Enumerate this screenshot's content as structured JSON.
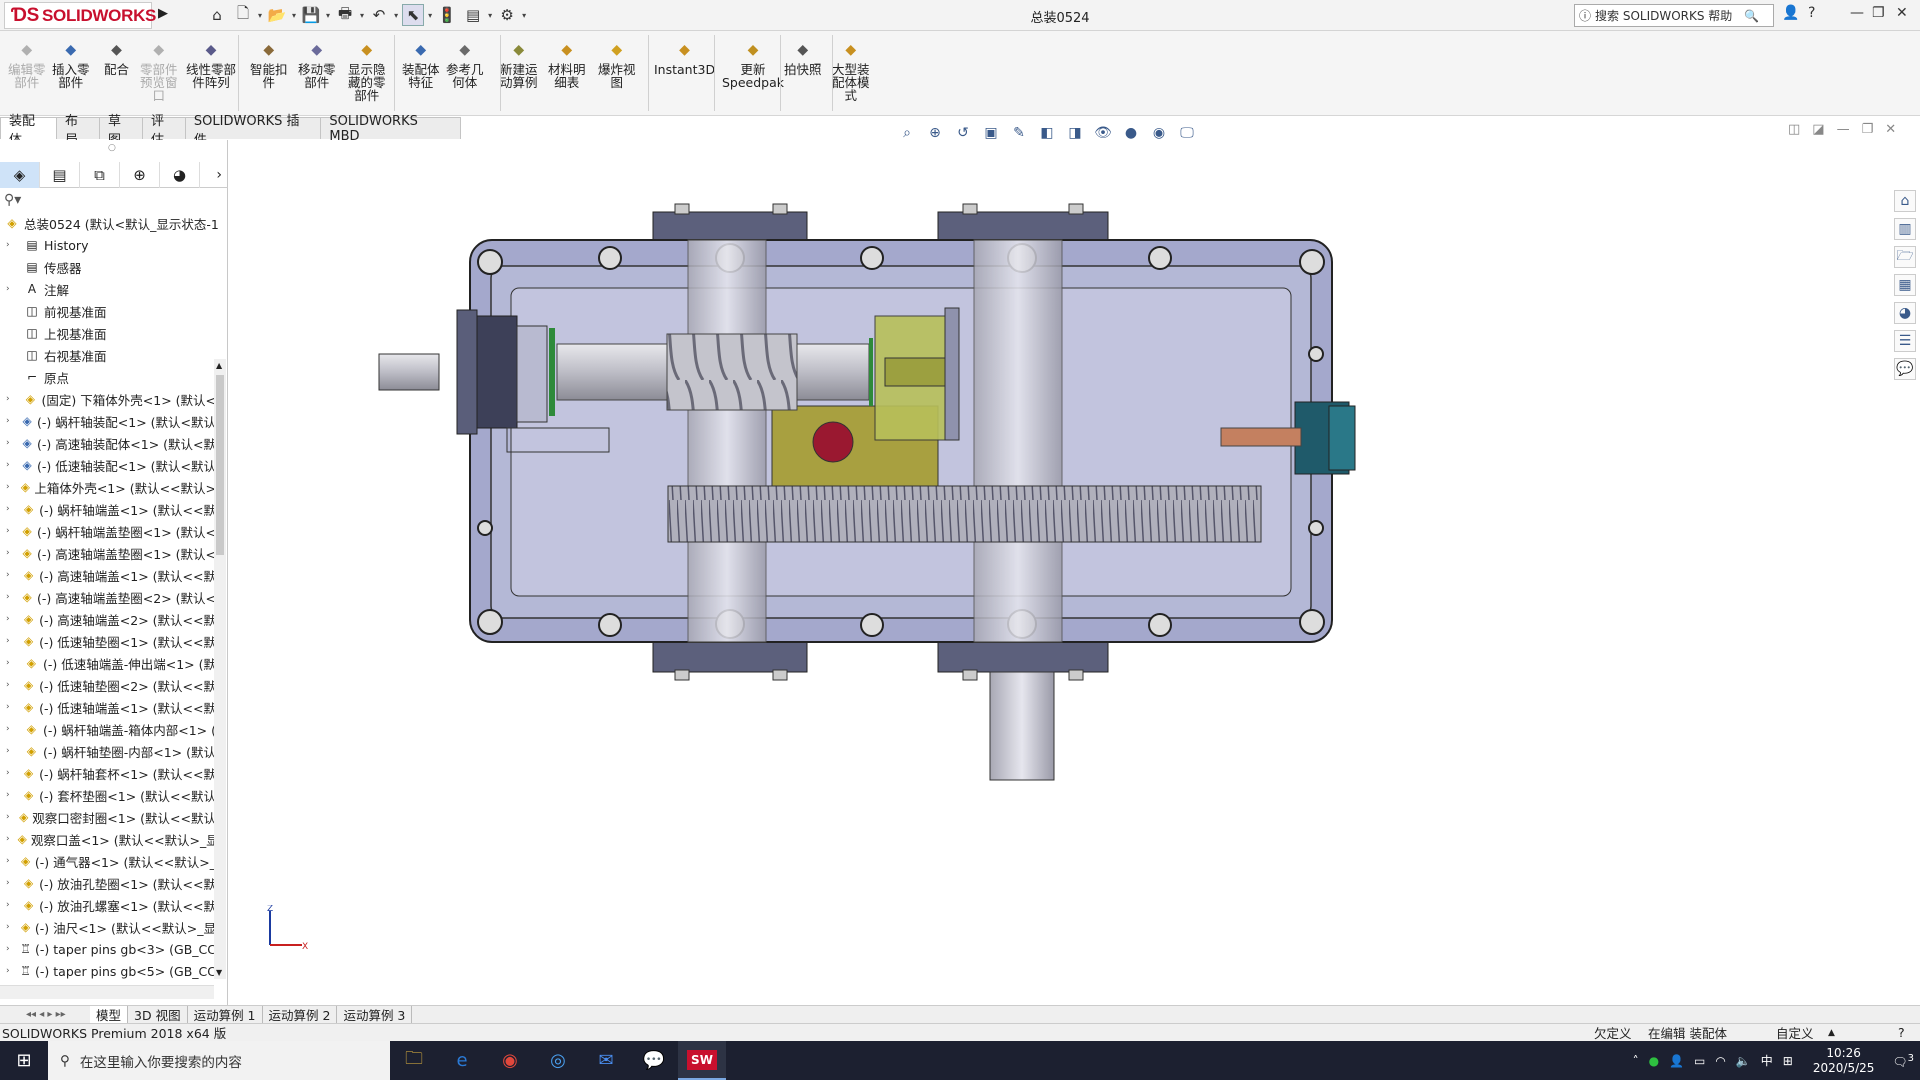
{
  "app": {
    "logo": "SOLIDWORKS",
    "doc_title": "总装0524",
    "help_search": "搜索 SOLIDWORKS 帮助"
  },
  "ribbon": {
    "buttons": [
      {
        "label": "编辑零\n部件",
        "icon": "edit-component-icon",
        "disabled": true
      },
      {
        "label": "插入零\n部件",
        "icon": "insert-components-icon"
      },
      {
        "label": "配合",
        "icon": "mate-icon"
      },
      {
        "label": "零部件\n预览窗\n口",
        "icon": "component-preview-icon",
        "disabled": true
      },
      {
        "label": "线性零部\n件阵列",
        "icon": "linear-pattern-icon"
      },
      {
        "label": "智能扣\n件",
        "icon": "smart-fasteners-icon"
      },
      {
        "label": "移动零\n部件",
        "icon": "move-component-icon"
      },
      {
        "label": "显示隐\n藏的零\n部件",
        "icon": "show-hidden-icon"
      },
      {
        "label": "装配体\n特征",
        "icon": "assembly-features-icon"
      },
      {
        "label": "参考几\n何体",
        "icon": "reference-geometry-icon"
      },
      {
        "label": "新建运\n动算例",
        "icon": "new-motion-study-icon"
      },
      {
        "label": "材料明\n细表",
        "icon": "bom-icon"
      },
      {
        "label": "爆炸视\n图",
        "icon": "exploded-view-icon"
      },
      {
        "label": "Instant3D",
        "icon": "instant3d-icon"
      },
      {
        "label": "更新\nSpeedpak",
        "icon": "speedpak-icon"
      },
      {
        "label": "拍快照",
        "icon": "snapshot-icon"
      },
      {
        "label": "大型装\n配体模\n式",
        "icon": "large-assembly-icon"
      }
    ]
  },
  "command_tabs": [
    "装配体",
    "布局",
    "草图",
    "评估",
    "SOLIDWORKS 插件",
    "SOLIDWORKS MBD"
  ],
  "tree": {
    "root": "总装0524  (默认<默认_显示状态-1",
    "items": [
      {
        "label": "History",
        "type": "folder",
        "expand": true
      },
      {
        "label": "传感器",
        "type": "folder"
      },
      {
        "label": "注解",
        "type": "annot",
        "expand": true
      },
      {
        "label": "前视基准面",
        "type": "plane"
      },
      {
        "label": "上视基准面",
        "type": "plane"
      },
      {
        "label": "右视基准面",
        "type": "plane"
      },
      {
        "label": "原点",
        "type": "origin"
      },
      {
        "label": "(固定) 下箱体外壳<1> (默认<",
        "type": "part",
        "expand": true
      },
      {
        "label": "(-) 蜗杆轴装配<1> (默认<默认",
        "type": "asm",
        "expand": true
      },
      {
        "label": "(-) 高速轴装配体<1> (默认<默",
        "type": "asm",
        "expand": true
      },
      {
        "label": "(-) 低速轴装配<1> (默认<默认",
        "type": "asm",
        "expand": true
      },
      {
        "label": "上箱体外壳<1> (默认<<默认>",
        "type": "part",
        "expand": true
      },
      {
        "label": "(-) 蜗杆轴端盖<1> (默认<<默",
        "type": "part",
        "expand": true
      },
      {
        "label": "(-) 蜗杆轴端盖垫圈<1> (默认<",
        "type": "part",
        "expand": true
      },
      {
        "label": "(-) 高速轴端盖垫圈<1> (默认<",
        "type": "part",
        "expand": true
      },
      {
        "label": "(-) 高速轴端盖<1> (默认<<默",
        "type": "part",
        "expand": true
      },
      {
        "label": "(-) 高速轴端盖垫圈<2> (默认<",
        "type": "part",
        "expand": true
      },
      {
        "label": "(-) 高速轴端盖<2> (默认<<默",
        "type": "part",
        "expand": true
      },
      {
        "label": "(-) 低速轴垫圈<1> (默认<<默",
        "type": "part",
        "expand": true
      },
      {
        "label": "(-) 低速轴端盖-伸出端<1> (默",
        "type": "part",
        "expand": true
      },
      {
        "label": "(-) 低速轴垫圈<2> (默认<<默",
        "type": "part",
        "expand": true
      },
      {
        "label": "(-) 低速轴端盖<1> (默认<<默",
        "type": "part",
        "expand": true
      },
      {
        "label": "(-) 蜗杆轴端盖-箱体内部<1> (",
        "type": "part",
        "expand": true
      },
      {
        "label": "(-) 蜗杆轴垫圈-内部<1> (默认",
        "type": "part",
        "expand": true
      },
      {
        "label": "(-) 蜗杆轴套杯<1> (默认<<默",
        "type": "part",
        "expand": true
      },
      {
        "label": "(-) 套杯垫圈<1> (默认<<默认",
        "type": "part",
        "expand": true
      },
      {
        "label": "观察口密封圈<1> (默认<<默认",
        "type": "part",
        "expand": true
      },
      {
        "label": "观察口盖<1> (默认<<默认>_显",
        "type": "part",
        "expand": true
      },
      {
        "label": "(-) 通气器<1> (默认<<默认>_",
        "type": "part",
        "expand": true
      },
      {
        "label": "(-) 放油孔垫圈<1> (默认<<默",
        "type": "part",
        "expand": true
      },
      {
        "label": "(-) 放油孔螺塞<1> (默认<<默",
        "type": "part",
        "expand": true
      },
      {
        "label": "(-) 油尺<1> (默认<<默认>_显",
        "type": "part",
        "expand": true
      },
      {
        "label": "(-) taper pins gb<3> (GB_CC",
        "type": "pin",
        "expand": true
      },
      {
        "label": "(-) taper pins gb<5> (GB_CC",
        "type": "pin",
        "expand": true
      }
    ]
  },
  "bottom_tabs": [
    "模型",
    "3D 视图",
    "运动算例 1",
    "运动算例 2",
    "运动算例 3"
  ],
  "status": {
    "version": "SOLIDWORKS Premium 2018 x64 版",
    "constraint": "欠定义",
    "mode": "在编辑 装配体",
    "units": "自定义"
  },
  "taskbar": {
    "search_placeholder": "在这里输入你要搜索的内容",
    "ime": "中",
    "time": "10:26",
    "date": "2020/5/25",
    "notif_count": "3"
  },
  "colors": {
    "brand": "#c8102e",
    "housing": "#9aa0c8",
    "highlight": "#cfe3f8"
  }
}
